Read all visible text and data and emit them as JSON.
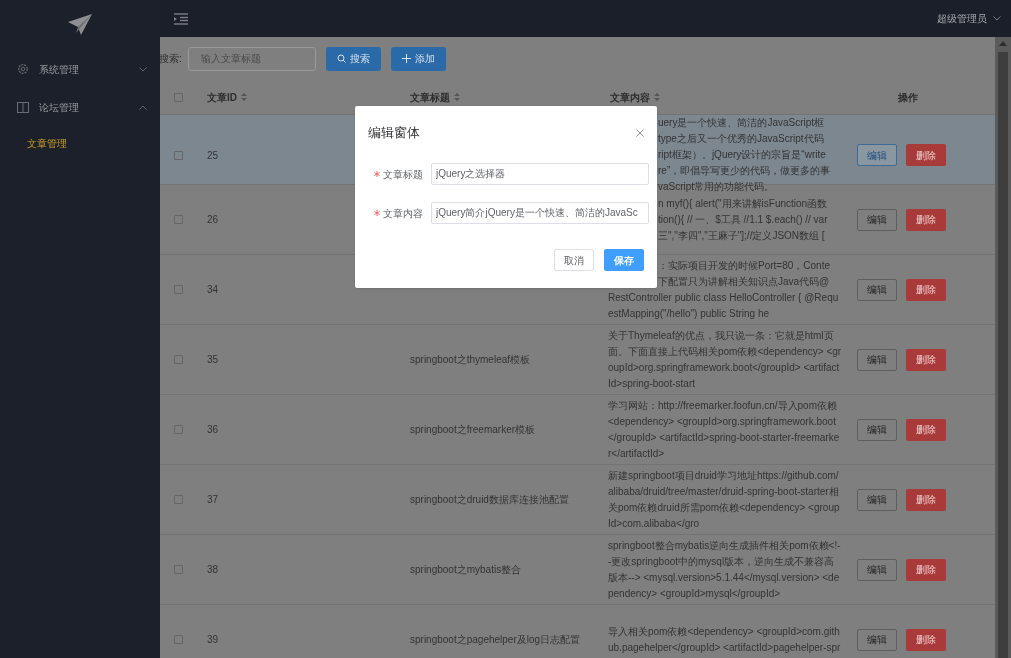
{
  "sidebar": {
    "items": [
      {
        "label": "系统管理",
        "expanded": false,
        "selected": false
      },
      {
        "label": "论坛管理",
        "expanded": true,
        "selected": false,
        "children": [
          {
            "label": "文章管理",
            "selected": true
          }
        ]
      }
    ]
  },
  "topbar": {
    "user": "超级管理员"
  },
  "toolbar": {
    "search_label": "搜索:",
    "search": {
      "placeholder": "输入文章标题"
    },
    "buttons": [
      {
        "label": "搜索",
        "kind": "search"
      },
      {
        "label": "添加",
        "kind": "add"
      }
    ]
  },
  "table": {
    "all_checked": false,
    "columns": [
      {
        "label": "文章ID",
        "sortable": true
      },
      {
        "label": "文章标题",
        "sortable": true
      },
      {
        "label": "文章内容",
        "sortable": true
      },
      {
        "label": "操作",
        "sortable": false
      }
    ],
    "rows": [
      {
        "id": "25",
        "selected": true,
        "checked": false,
        "content": [
          {
            "text": "uery是一个快速、简洁的JavaScript框",
            "kind": "cut"
          },
          {
            "text": "type之后又一个优秀的JavaScript代码",
            "kind": "cut"
          },
          {
            "text": "ript框架）。jQuery设计的宗旨是“write",
            "kind": "cut"
          },
          {
            "text": "re”，即倡导写更少的代码，做更多的事",
            "kind": "cut"
          },
          {
            "text": "vaScript常用的功能代码。",
            "kind": "cut"
          }
        ],
        "actions": [
          "编辑",
          "删除"
        ]
      },
      {
        "id": "26",
        "selected": false,
        "checked": false,
        "content": [
          {
            "text": "n myf(){ alert(\"用来讲解isFunction函数",
            "kind": "cut"
          },
          {
            "text": "tion(){ // 一、$工具 //1.1 $.each() // var",
            "kind": "cut"
          },
          {
            "text": "三\",\"李四\",\"王麻子\"];//定义JSON数组 [",
            "kind": "cut"
          }
        ],
        "actions": [
          "编辑",
          "删除"
        ]
      },
      {
        "id": "34",
        "selected": false,
        "checked": false,
        "content": [
          {
            "text": "：实际项目开发的时候Port=80，Conte",
            "kind": "cut"
          },
          {
            "text": "下配置只为讲解相关知识点Java代码@",
            "kind": "cut"
          },
          {
            "text": "RestController public class HelloController { @Requ",
            "kind": "full"
          },
          {
            "text": "estMapping(\"/hello\") public String he",
            "kind": "full"
          }
        ],
        "actions": [
          "编辑",
          "删除"
        ]
      },
      {
        "id": "35",
        "selected": false,
        "checked": false,
        "title": "springboot之thymeleaf模板",
        "content": [
          {
            "text": "关于Thymeleaf的优点，我只说一条：它就是html页",
            "kind": "full"
          },
          {
            "text": "面。下面直接上代码相关pom依赖<dependency> <gr",
            "kind": "full"
          },
          {
            "text": "oupId>org.springframework.boot</groupId> <artifact",
            "kind": "full"
          },
          {
            "text": "Id>spring-boot-start",
            "kind": "full"
          }
        ],
        "actions": [
          "编辑",
          "删除"
        ]
      },
      {
        "id": "36",
        "selected": false,
        "checked": false,
        "title": "springboot之freemarker模板",
        "content": [
          {
            "text": "学习网站：http://freemarker.foofun.cn/导入pom依赖",
            "kind": "full"
          },
          {
            "text": "<dependency> <groupId>org.springframework.boot",
            "kind": "full"
          },
          {
            "text": "</groupId> <artifactId>spring-boot-starter-freemarke",
            "kind": "full"
          },
          {
            "text": "r</artifactId>",
            "kind": "full"
          }
        ],
        "actions": [
          "编辑",
          "删除"
        ]
      },
      {
        "id": "37",
        "selected": false,
        "checked": false,
        "title": "springboot之druid数据库连接池配置",
        "content": [
          {
            "text": "新建springboot项目druid学习地址https://github.com/",
            "kind": "full"
          },
          {
            "text": "alibaba/druid/tree/master/druid-spring-boot-starter相",
            "kind": "full"
          },
          {
            "text": "关pom依赖druid所需pom依赖<dependency> <group",
            "kind": "full"
          },
          {
            "text": "Id>com.alibaba</gro",
            "kind": "full"
          }
        ],
        "actions": [
          "编辑",
          "删除"
        ]
      },
      {
        "id": "38",
        "selected": false,
        "checked": false,
        "title": "springboot之mybatis整合",
        "content": [
          {
            "text": "springboot整合mybatis逆向生成插件相关pom依赖<!-",
            "kind": "full"
          },
          {
            "text": "-更改springboot中的mysql版本，逆向生成不兼容高",
            "kind": "full"
          },
          {
            "text": "版本--> <mysql.version>5.1.44</mysql.version> <de",
            "kind": "full"
          },
          {
            "text": "pendency> <groupId>mysql</groupId>",
            "kind": "full"
          }
        ],
        "actions": [
          "编辑",
          "删除"
        ]
      },
      {
        "id": "39",
        "selected": false,
        "checked": false,
        "title": "springboot之pagehelper及log日志配置",
        "content": [
          {
            "text": "导入相关pom依赖<dependency> <groupId>com.gith",
            "kind": "full"
          },
          {
            "text": "ub.pagehelper</groupId> <artifactId>pagehelper-spr",
            "kind": "full"
          }
        ],
        "actions": [
          "编辑",
          "删除"
        ]
      }
    ]
  },
  "dialog": {
    "title": "编辑窗体",
    "fields": [
      {
        "label": "文章标题",
        "required": true,
        "value": "jQuery之选择器"
      },
      {
        "label": "文章内容",
        "required": true,
        "value": "jQuery简介jQuery是一个快速、简洁的JavaSc"
      }
    ],
    "buttons": [
      {
        "label": "取消",
        "kind": "cancel"
      },
      {
        "label": "保存",
        "kind": "primary"
      }
    ]
  }
}
